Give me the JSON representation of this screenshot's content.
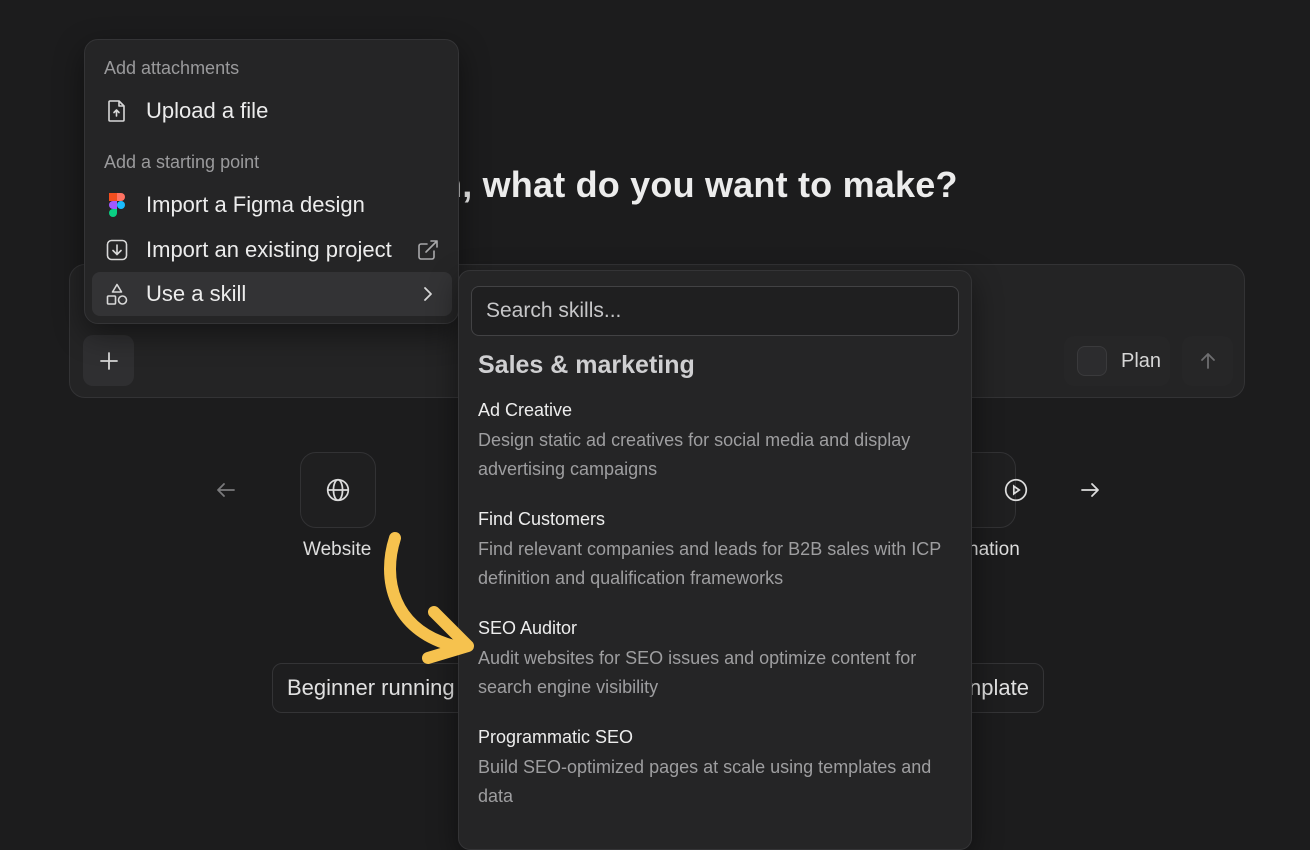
{
  "heading": "n, what do you want to make?",
  "composer": {
    "plan_label": "Plan"
  },
  "carousel": {
    "tiles": [
      {
        "label": "Website",
        "icon": "globe-icon"
      },
      {
        "label": "nation",
        "icon": "play-circle-icon"
      }
    ]
  },
  "chips": [
    "Beginner running",
    "nplate"
  ],
  "attachments_menu": {
    "section_attachments": "Add attachments",
    "upload_file": "Upload a file",
    "section_starting_point": "Add a starting point",
    "import_figma": "Import a Figma design",
    "import_project": "Import an existing project",
    "use_skill": "Use a skill"
  },
  "skills_menu": {
    "search_placeholder": "Search skills...",
    "category": "Sales & marketing",
    "skills": [
      {
        "name": "Ad Creative",
        "description": "Design static ad creatives for social media and display advertising campaigns"
      },
      {
        "name": "Find Customers",
        "description": "Find relevant companies and leads for B2B sales with ICP definition and qualification frameworks"
      },
      {
        "name": "SEO Auditor",
        "description": "Audit websites for SEO issues and optimize content for search engine visibility"
      },
      {
        "name": "Programmatic SEO",
        "description": "Build SEO-optimized pages at scale using templates and data"
      }
    ]
  },
  "colors": {
    "background": "#1c1c1d",
    "panel": "#252526",
    "annotation_arrow": "#f6c24e"
  }
}
